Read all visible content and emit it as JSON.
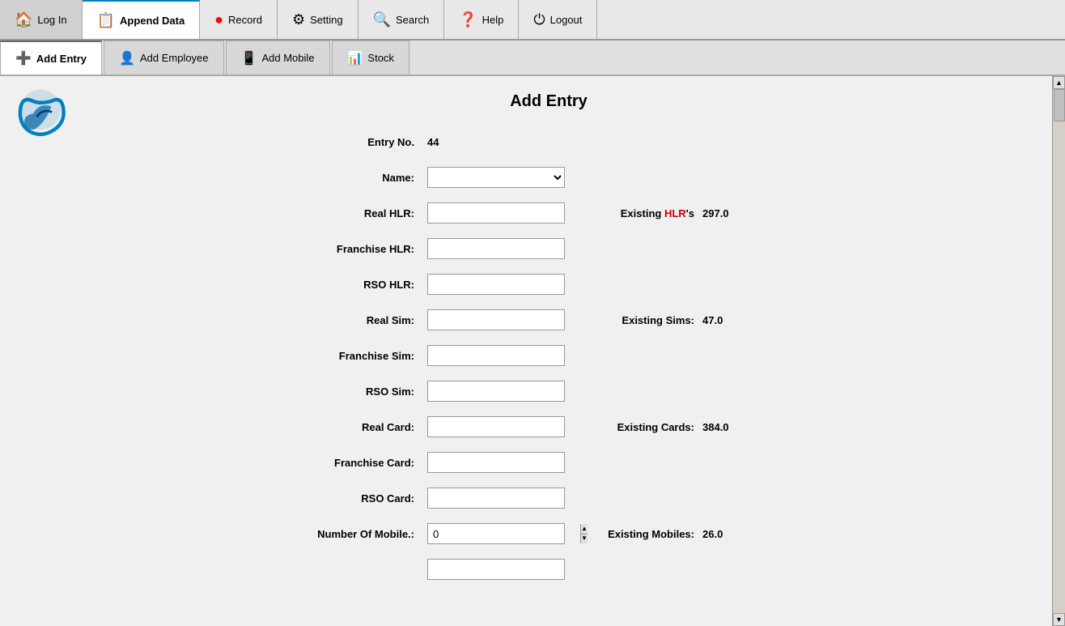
{
  "topNav": {
    "buttons": [
      {
        "id": "login",
        "label": "Log In",
        "icon": "🏠",
        "active": false
      },
      {
        "id": "append-data",
        "label": "Append Data",
        "icon": "📋",
        "active": true
      },
      {
        "id": "record",
        "label": "Record",
        "icon": "🔴",
        "active": false
      },
      {
        "id": "setting",
        "label": "Setting",
        "icon": "⚙",
        "active": false
      },
      {
        "id": "search",
        "label": "Search",
        "icon": "🔍",
        "active": false
      },
      {
        "id": "help",
        "label": "Help",
        "icon": "❓",
        "active": false
      },
      {
        "id": "logout",
        "label": "Logout",
        "icon": "⏻",
        "active": false
      }
    ]
  },
  "tabBar": {
    "tabs": [
      {
        "id": "add-entry",
        "label": "Add Entry",
        "icon": "➕",
        "active": true
      },
      {
        "id": "add-employee",
        "label": "Add Employee",
        "icon": "👤",
        "active": false
      },
      {
        "id": "add-mobile",
        "label": "Add Mobile",
        "icon": "📱",
        "active": false
      },
      {
        "id": "stock",
        "label": "Stock",
        "icon": "📊",
        "active": false
      }
    ]
  },
  "form": {
    "title": "Add Entry",
    "entryNoLabel": "Entry No.",
    "entryNoValue": "44",
    "nameLabel": "Name:",
    "nameOptions": [
      ""
    ],
    "realHlrLabel": "Real HLR:",
    "existingHlrsLabel": "Existing HLR's",
    "existingHlrsValue": "297.0",
    "franchiseHlrLabel": "Franchise HLR:",
    "rsoHlrLabel": "RSO HLR:",
    "realSimLabel": "Real Sim:",
    "existingSimsLabel": "Existing Sims:",
    "existingSimsValue": "47.0",
    "franchiseSimLabel": "Franchise Sim:",
    "rsoSimLabel": "RSO Sim:",
    "realCardLabel": "Real Card:",
    "existingCardsLabel": "Existing Cards:",
    "existingCardsValue": "384.0",
    "franchiseCardLabel": "Franchise Card:",
    "rsoCardLabel": "RSO Card:",
    "numberOfMobileLabel": "Number Of Mobile.:",
    "numberOfMobileValue": "0",
    "existingMobilesLabel": "Existing Mobiles:",
    "existingMobilesValue": "26.0"
  }
}
